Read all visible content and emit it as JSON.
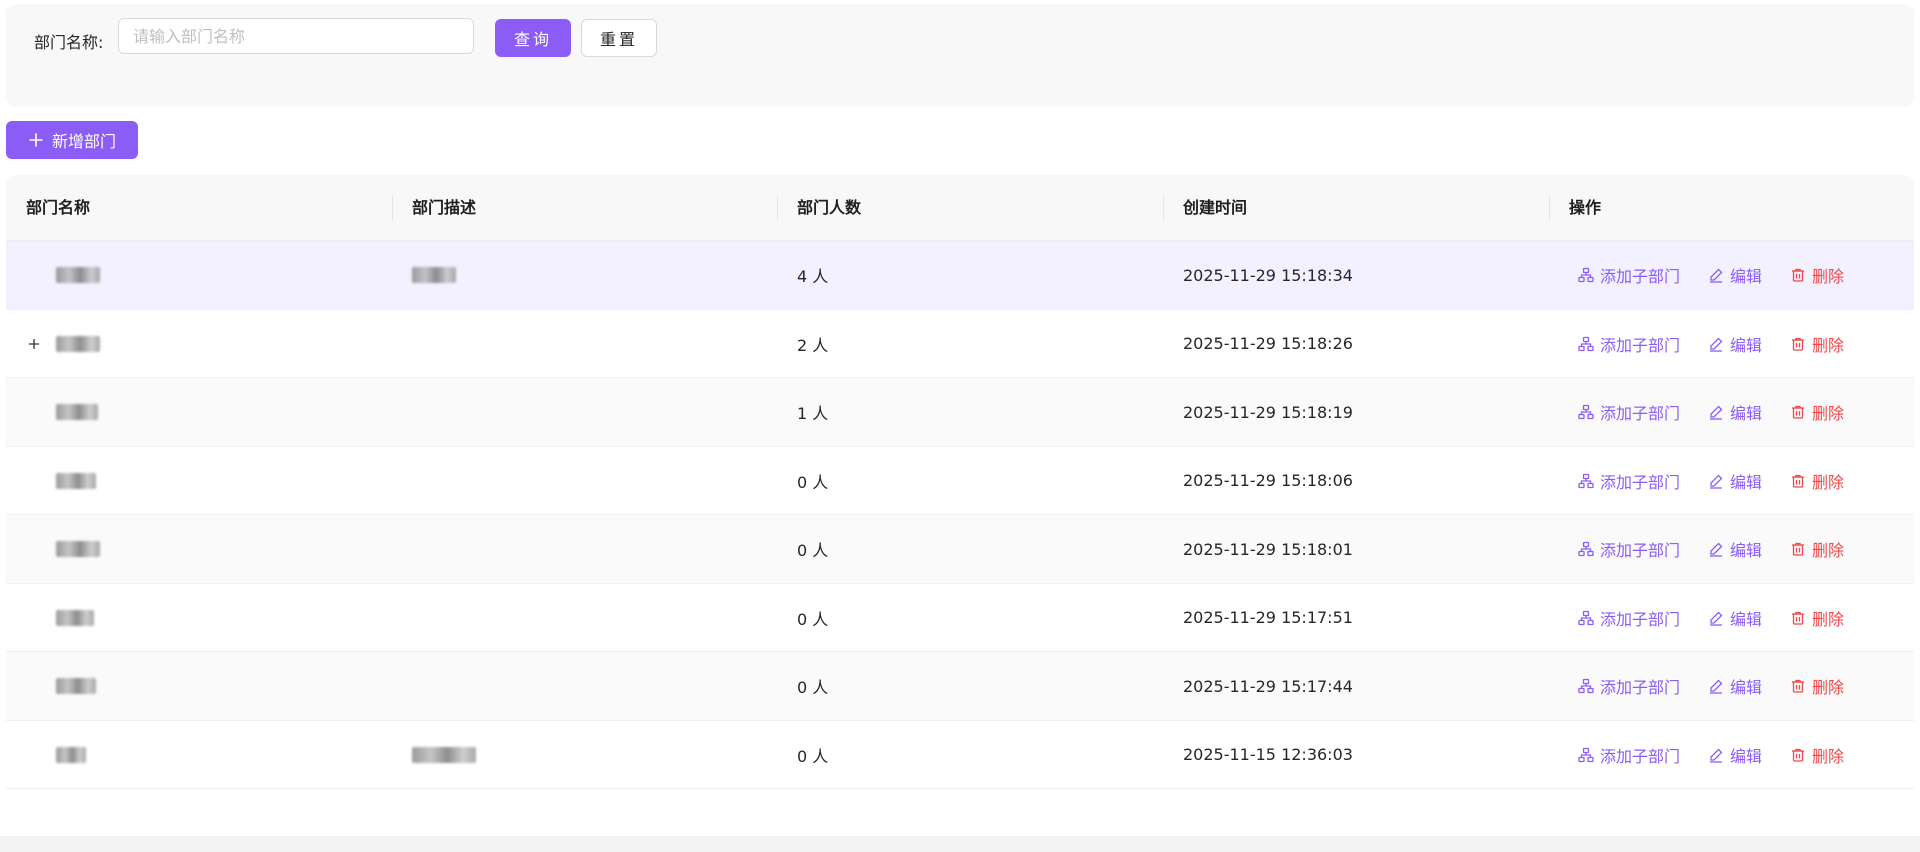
{
  "search": {
    "label": "部门名称:",
    "placeholder": "请输入部门名称",
    "value": "",
    "query_label": "查询",
    "reset_label": "重置"
  },
  "toolbar": {
    "add_label": "新增部门"
  },
  "table": {
    "columns": [
      "部门名称",
      "部门描述",
      "部门人数",
      "创建时间",
      "操作"
    ],
    "actions": {
      "add_child": "添加子部门",
      "edit": "编辑",
      "delete": "删除"
    },
    "rows": [
      {
        "count": "4 人",
        "created": "2025-11-29 15:18:34",
        "has_children": false,
        "selected": true
      },
      {
        "count": "2 人",
        "created": "2025-11-29 15:18:26",
        "has_children": true,
        "selected": false
      },
      {
        "count": "1 人",
        "created": "2025-11-29 15:18:19",
        "has_children": false,
        "selected": false
      },
      {
        "count": "0 人",
        "created": "2025-11-29 15:18:06",
        "has_children": false,
        "selected": false
      },
      {
        "count": "0 人",
        "created": "2025-11-29 15:18:01",
        "has_children": false,
        "selected": false
      },
      {
        "count": "0 人",
        "created": "2025-11-29 15:17:51",
        "has_children": false,
        "selected": false
      },
      {
        "count": "0 人",
        "created": "2025-11-29 15:17:44",
        "has_children": false,
        "selected": false
      },
      {
        "count": "0 人",
        "created": "2025-11-15 12:36:03",
        "has_children": false,
        "selected": false
      }
    ]
  },
  "colors": {
    "primary": "#8b5cf6",
    "danger": "#f04848",
    "selected_row": "#f3f0ff"
  },
  "icons": {
    "plus": "plus-icon",
    "expand": "expand-plus-icon",
    "add_child": "org-tree-icon",
    "edit": "edit-pen-icon",
    "delete": "trash-icon"
  }
}
